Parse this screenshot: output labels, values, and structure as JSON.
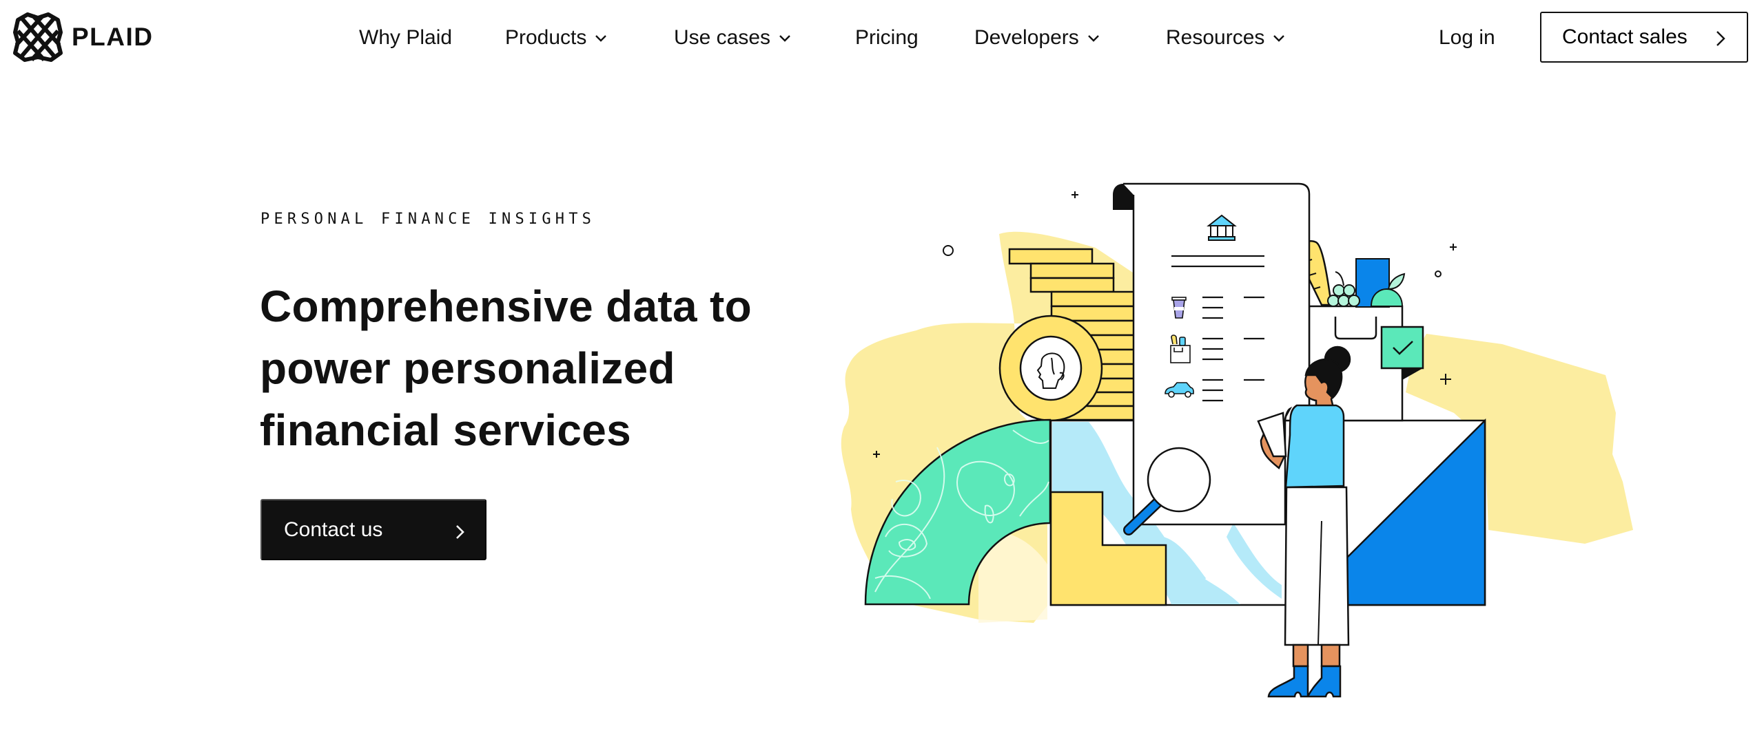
{
  "brand": {
    "name": "PLAID",
    "logo_icon": "plaid-tartan-logo-icon"
  },
  "nav": {
    "items": [
      {
        "label": "Why Plaid",
        "has_dropdown": false
      },
      {
        "label": "Products",
        "has_dropdown": true
      },
      {
        "label": "Use cases",
        "has_dropdown": true
      },
      {
        "label": "Pricing",
        "has_dropdown": false
      },
      {
        "label": "Developers",
        "has_dropdown": true
      },
      {
        "label": "Resources",
        "has_dropdown": true
      }
    ],
    "login_label": "Log in",
    "contact_sales_label": "Contact sales",
    "contact_sales_icon": "chevron-right-icon",
    "dropdown_icon": "chevron-down-icon"
  },
  "hero": {
    "eyebrow": "PERSONAL FINANCE INSIGHTS",
    "headline_lines": [
      "Comprehensive data to",
      "power personalized",
      "financial services"
    ],
    "cta_label": "Contact us",
    "cta_icon": "chevron-right-icon"
  },
  "illustration": {
    "description": "Woman reviewing a financial statement with bank, coffee, groceries and car transactions, coin stack, grocery bag and verified check tag",
    "statement_icons": [
      "bank-icon",
      "coffee-cup-icon",
      "grocery-bag-icon",
      "car-icon"
    ],
    "colors": {
      "yellow": "#FFE36E",
      "pale_yellow": "#FCEDA0",
      "mint": "#5BE8B9",
      "light_blue": "#B5EAF9",
      "sky_blue": "#5FD4FB",
      "blue": "#0A85EA",
      "skin": "#E5935E",
      "ink": "#111111",
      "lavender": "#A9A4E8"
    }
  }
}
